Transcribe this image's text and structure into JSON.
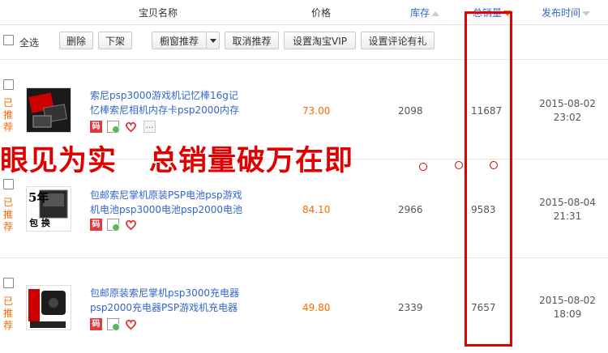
{
  "header": {
    "columns": {
      "name": "宝贝名称",
      "price": "价格",
      "stock": "库存",
      "sales": "总销量",
      "publish_time": "发布时间"
    }
  },
  "toolbar": {
    "select_all": "全选",
    "delete": "删除",
    "delist": "下架",
    "window_recommend": "橱窗推荐",
    "cancel_recommend": "取消推荐",
    "set_vip": "设置淘宝VIP",
    "set_review_gift": "设置评论有礼"
  },
  "rows": [
    {
      "recommend": "已推荐",
      "title_line1": "索尼psp3000游戏机记忆棒16g记",
      "title_line2": "忆棒索尼相机内存卡psp2000内存",
      "icon_text": "码",
      "more": "...",
      "price": "73.00",
      "stock": "2098",
      "sales": "11687",
      "date": "2015-08-02",
      "time": "23:02"
    },
    {
      "recommend": "已推荐",
      "thumb_text_top": "5年",
      "thumb_text_bottom": "包 换",
      "title_line1": "包邮索尼掌机原装PSP电池psp游戏",
      "title_line2": "机电池psp3000电池psp2000电池",
      "icon_text": "码",
      "price": "84.10",
      "stock": "2966",
      "sales": "9583",
      "date": "2015-08-04",
      "time": "21:31"
    },
    {
      "recommend": "已推荐",
      "title_line1": "包邮原装索尼掌机psp3000充电器",
      "title_line2": "psp2000充电器PSP游戏机充电器",
      "icon_text": "码",
      "price": "49.80",
      "stock": "2339",
      "sales": "7657",
      "date": "2015-08-02",
      "time": "18:09"
    }
  ],
  "overlay": {
    "left_text": "眼见为实",
    "right_text": "总销量破万在即"
  },
  "colors": {
    "link": "#3366cc",
    "price": "#ff6600",
    "highlight": "#e00000"
  }
}
